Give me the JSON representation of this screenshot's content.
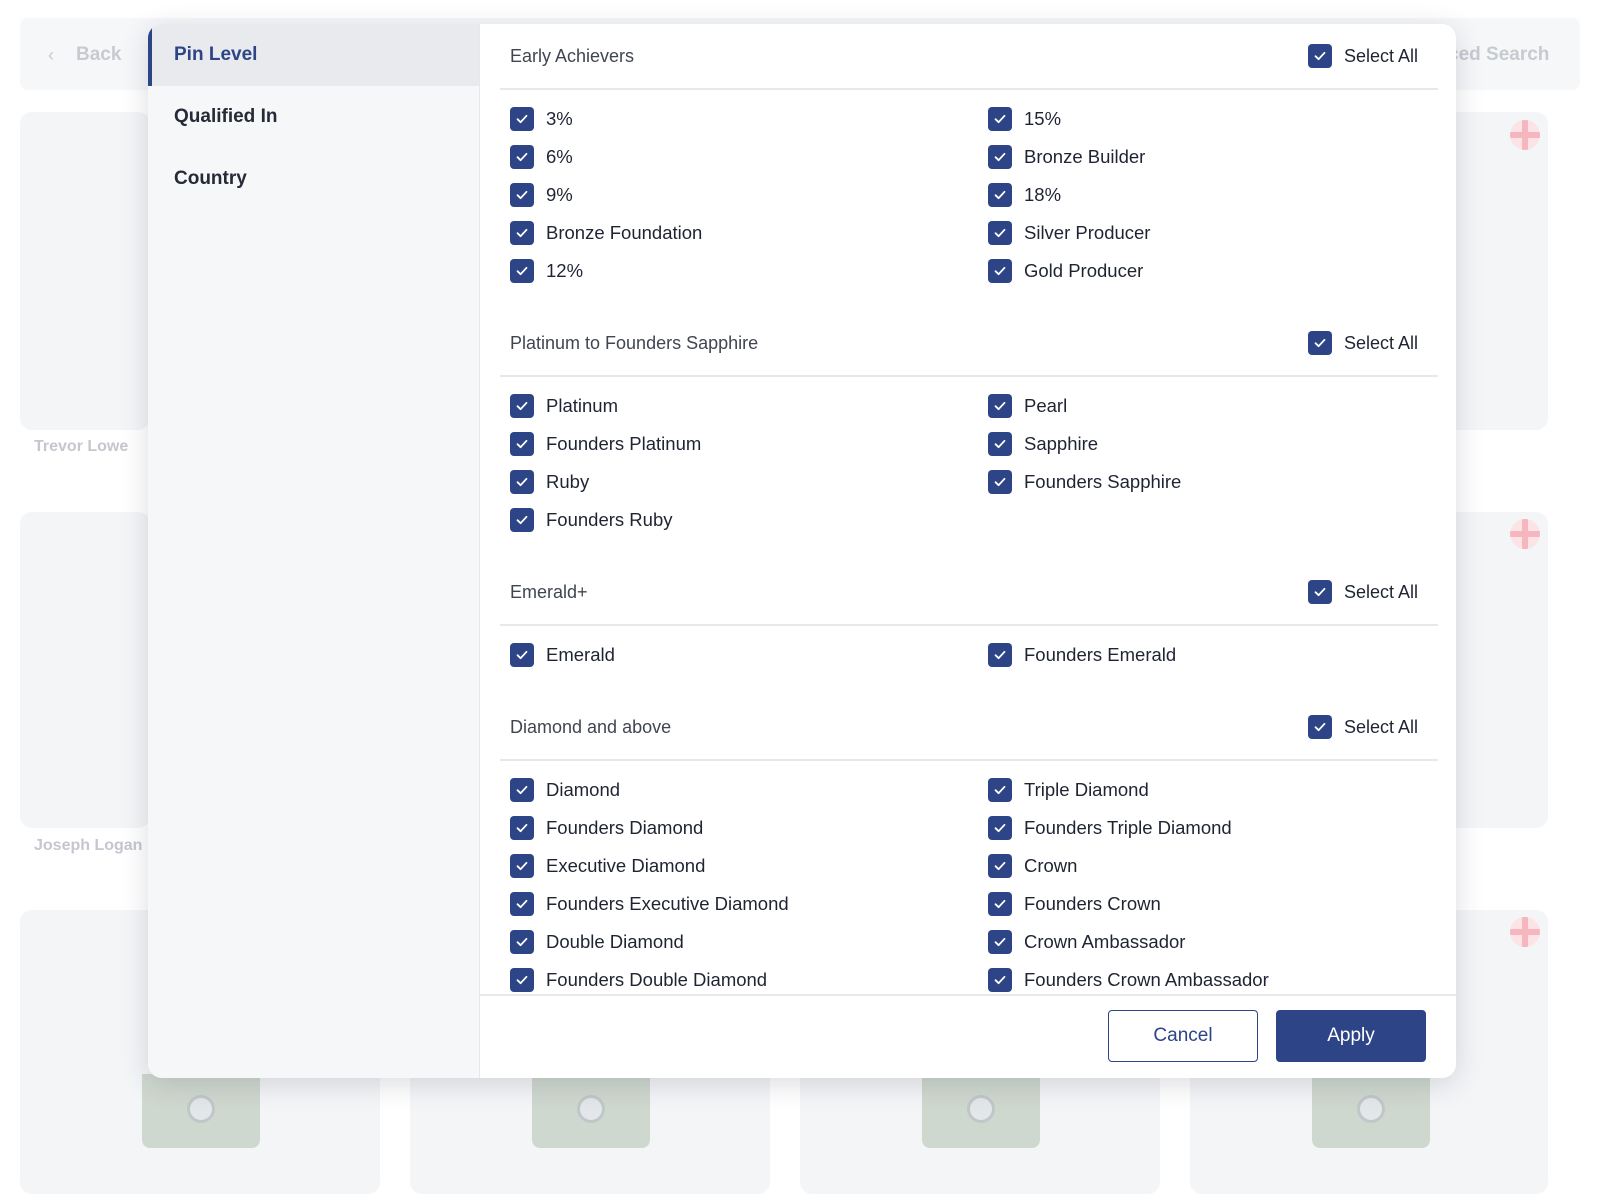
{
  "background": {
    "back_label": "Back",
    "advanced_search_label": "ced Search",
    "card_names": [
      "Trevor Lowe",
      "Joseph Logan"
    ]
  },
  "sidebar": {
    "items": [
      {
        "label": "Pin Level",
        "active": true
      },
      {
        "label": "Qualified In",
        "active": false
      },
      {
        "label": "Country",
        "active": false
      }
    ]
  },
  "select_all_label": "Select All",
  "sections": [
    {
      "title": "Early Achievers",
      "select_all_checked": true,
      "items": [
        {
          "label": "3%",
          "checked": true
        },
        {
          "label": "15%",
          "checked": true
        },
        {
          "label": "6%",
          "checked": true
        },
        {
          "label": "Bronze Builder",
          "checked": true
        },
        {
          "label": "9%",
          "checked": true
        },
        {
          "label": "18%",
          "checked": true
        },
        {
          "label": "Bronze Foundation",
          "checked": true
        },
        {
          "label": "Silver Producer",
          "checked": true
        },
        {
          "label": "12%",
          "checked": true
        },
        {
          "label": "Gold Producer",
          "checked": true
        }
      ]
    },
    {
      "title": "Platinum to Founders Sapphire",
      "select_all_checked": true,
      "items": [
        {
          "label": "Platinum",
          "checked": true
        },
        {
          "label": "Pearl",
          "checked": true
        },
        {
          "label": "Founders Platinum",
          "checked": true
        },
        {
          "label": "Sapphire",
          "checked": true
        },
        {
          "label": "Ruby",
          "checked": true
        },
        {
          "label": "Founders Sapphire",
          "checked": true
        },
        {
          "label": "Founders Ruby",
          "checked": true
        }
      ]
    },
    {
      "title": "Emerald+",
      "select_all_checked": true,
      "items": [
        {
          "label": "Emerald",
          "checked": true
        },
        {
          "label": "Founders Emerald",
          "checked": true
        }
      ]
    },
    {
      "title": "Diamond and above",
      "select_all_checked": true,
      "items": [
        {
          "label": "Diamond",
          "checked": true
        },
        {
          "label": "Triple Diamond",
          "checked": true
        },
        {
          "label": "Founders Diamond",
          "checked": true
        },
        {
          "label": "Founders Triple Diamond",
          "checked": true
        },
        {
          "label": "Executive Diamond",
          "checked": true
        },
        {
          "label": "Crown",
          "checked": true
        },
        {
          "label": "Founders Executive Diamond",
          "checked": true
        },
        {
          "label": "Founders Crown",
          "checked": true
        },
        {
          "label": "Double Diamond",
          "checked": true
        },
        {
          "label": "Crown Ambassador",
          "checked": true
        },
        {
          "label": "Founders Double Diamond",
          "checked": true
        },
        {
          "label": "Founders Crown Ambassador",
          "checked": true
        }
      ]
    }
  ],
  "footer": {
    "cancel_label": "Cancel",
    "apply_label": "Apply"
  },
  "colors": {
    "accent": "#2d4486",
    "sidebar_bg": "#f6f7f9",
    "divider": "#e6e8ec"
  }
}
